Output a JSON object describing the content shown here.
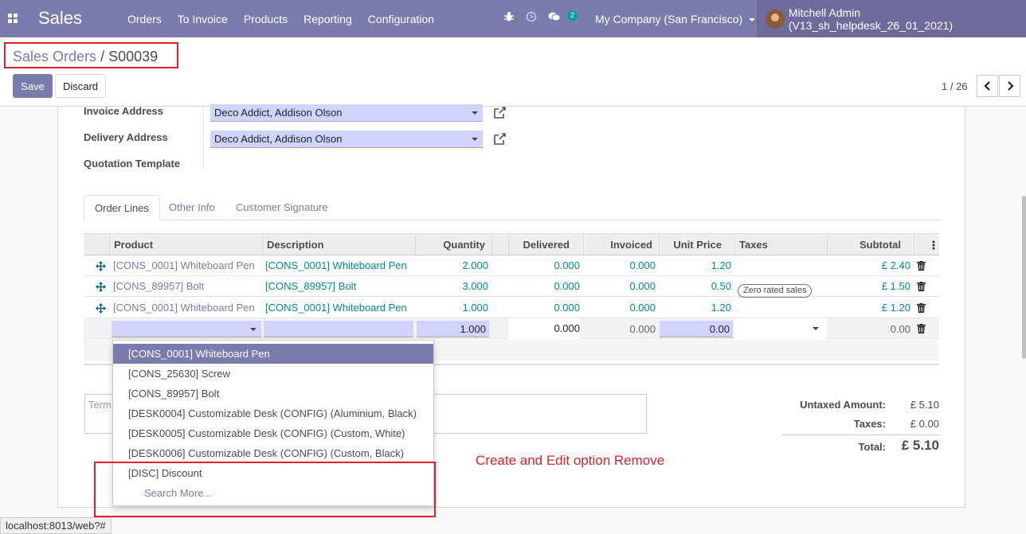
{
  "navbar": {
    "app_name": "Sales",
    "menu": [
      "Orders",
      "To Invoice",
      "Products",
      "Reporting",
      "Configuration"
    ],
    "chat_badge": "2",
    "company": "My Company (San Francisco)",
    "user": "Mitchell Admin (V13_sh_helpdesk_26_01_2021)",
    "icons": [
      "apps-grid-icon",
      "bug-icon",
      "clock-icon",
      "chat-icon"
    ]
  },
  "control_panel": {
    "breadcrumb_parent": "Sales Orders",
    "breadcrumb_sep": "/",
    "breadcrumb_current": "S00039",
    "save_label": "Save",
    "discard_label": "Discard",
    "pager": "1 / 26"
  },
  "form": {
    "invoice_address_label": "Invoice Address",
    "invoice_address": "Deco Addict, Addison Olson",
    "delivery_address_label": "Delivery Address",
    "delivery_address": "Deco Addict, Addison Olson",
    "quotation_template_label": "Quotation Template"
  },
  "tabs": [
    "Order Lines",
    "Other Info",
    "Customer Signature"
  ],
  "table": {
    "headers": {
      "product": "Product",
      "description": "Description",
      "quantity": "Quantity",
      "delivered": "Delivered",
      "invoiced": "Invoiced",
      "unit_price": "Unit Price",
      "taxes": "Taxes",
      "subtotal": "Subtotal"
    },
    "rows": [
      {
        "product": "[CONS_0001] Whiteboard Pen",
        "description": "[CONS_0001] Whiteboard Pen",
        "quantity": "2.000",
        "delivered": "0.000",
        "invoiced": "0.000",
        "unit_price": "1.20",
        "tax": "",
        "subtotal": "£ 2.40"
      },
      {
        "product": "[CONS_89957] Bolt",
        "description": "[CONS_89957] Bolt",
        "quantity": "3.000",
        "delivered": "0.000",
        "invoiced": "0.000",
        "unit_price": "0.50",
        "tax": "Zero rated sales",
        "subtotal": "£ 1.50"
      },
      {
        "product": "[CONS_0001] Whiteboard Pen",
        "description": "[CONS_0001] Whiteboard Pen",
        "quantity": "1.000",
        "delivered": "0.000",
        "invoiced": "0.000",
        "unit_price": "1.20",
        "tax": "",
        "subtotal": "£ 1.20"
      }
    ],
    "edit_row": {
      "quantity": "1.000",
      "delivered": "0.000",
      "invoiced": "0.000",
      "unit_price": "0.00",
      "subtotal": "0.00"
    }
  },
  "dropdown": {
    "items": [
      "[CONS_0001] Whiteboard Pen",
      "[CONS_25630] Screw",
      "[CONS_89957] Bolt",
      "[DESK0004] Customizable Desk (CONFIG) (Aluminium, Black)",
      "[DESK0005] Customizable Desk (CONFIG) (Custom, White)",
      "[DESK0006] Customizable Desk (CONFIG) (Custom, Black)",
      "[DISC] Discount"
    ],
    "search_more": "Search More..."
  },
  "terms_placeholder": "Term",
  "totals": {
    "untaxed_label": "Untaxed Amount:",
    "untaxed_value": "£ 5.10",
    "taxes_label": "Taxes:",
    "taxes_value": "£ 0.00",
    "total_label": "Total:",
    "total_value": "£ 5.10"
  },
  "annotation": "Create and Edit option Remove",
  "status_url": "localhost:8013/web?#",
  "colors": {
    "primary": "#7c7bad",
    "link_teal": "#008f8c",
    "annotation_red": "#e0202b",
    "m2o_bg": "#d2d2ff"
  }
}
